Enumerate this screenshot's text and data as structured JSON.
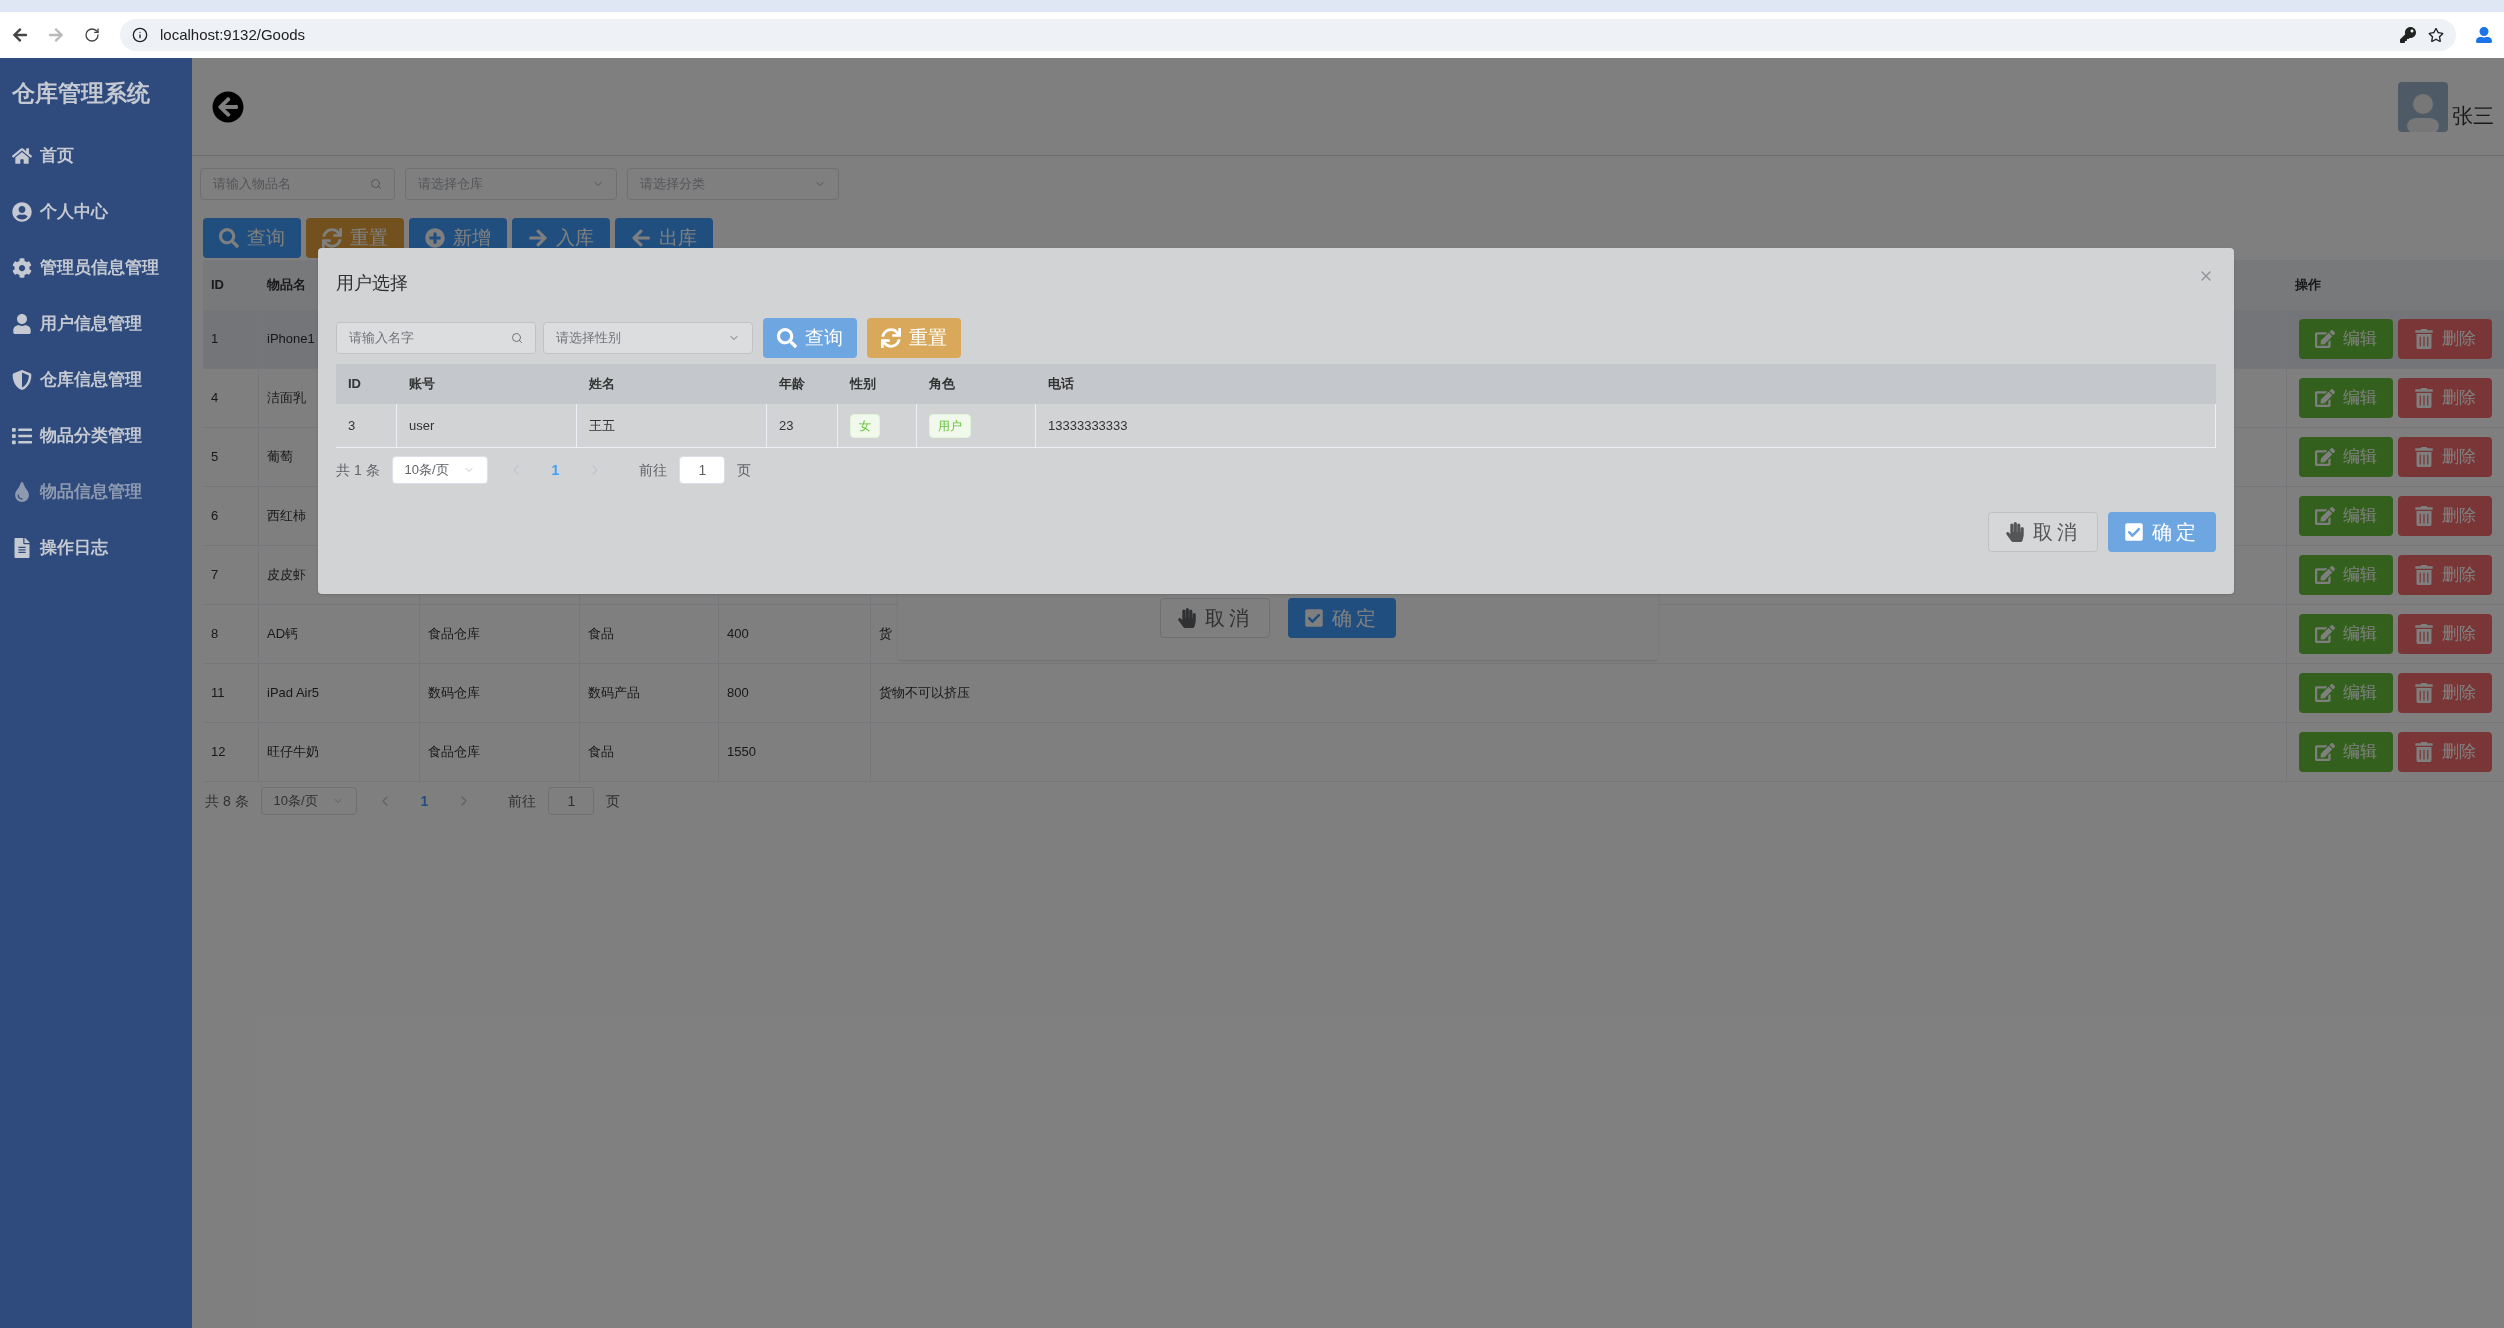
{
  "browser": {
    "url": "localhost:9132/Goods"
  },
  "sidebar": {
    "title": "仓库管理系统",
    "items": [
      {
        "label": "首页",
        "kind": "home",
        "selected": false
      },
      {
        "label": "个人中心",
        "kind": "profile",
        "selected": false
      },
      {
        "label": "管理员信息管理",
        "kind": "admin",
        "selected": false
      },
      {
        "label": "用户信息管理",
        "kind": "user",
        "selected": false
      },
      {
        "label": "仓库信息管理",
        "kind": "storage",
        "selected": false
      },
      {
        "label": "物品分类管理",
        "kind": "category",
        "selected": false
      },
      {
        "label": "物品信息管理",
        "kind": "goods",
        "selected": true
      },
      {
        "label": "操作日志",
        "kind": "log",
        "selected": false
      }
    ]
  },
  "header": {
    "user_name": "张三"
  },
  "filters": [
    {
      "placeholder": "请输入物品名",
      "kind": "search"
    },
    {
      "placeholder": "请选择仓库",
      "kind": "select"
    },
    {
      "placeholder": "请选择分类",
      "kind": "select"
    }
  ],
  "toolbar": [
    {
      "label": "查询",
      "kind": "search"
    },
    {
      "label": "重置",
      "kind": "reset"
    },
    {
      "label": "新增",
      "kind": "add"
    },
    {
      "label": "入库",
      "kind": "in"
    },
    {
      "label": "出库",
      "kind": "out"
    }
  ],
  "table": {
    "columns": [
      "ID",
      "物品名",
      null,
      null,
      null,
      null,
      "操作"
    ],
    "rows": [
      {
        "cells": [
          "1",
          "iPhone1",
          null,
          null,
          null,
          null
        ],
        "selected": true,
        "actions": [
          "编辑",
          "删除"
        ]
      },
      {
        "cells": [
          "4",
          "洁面乳",
          null,
          null,
          null,
          null
        ],
        "selected": false,
        "actions": [
          "编辑",
          "删除"
        ]
      },
      {
        "cells": [
          "5",
          "葡萄",
          null,
          null,
          null,
          null
        ],
        "selected": false,
        "actions": [
          "编辑",
          "删除"
        ]
      },
      {
        "cells": [
          "6",
          "西红柿",
          null,
          null,
          null,
          null
        ],
        "selected": false,
        "actions": [
          "编辑",
          "删除"
        ]
      },
      {
        "cells": [
          "7",
          "皮皮虾",
          null,
          null,
          null,
          null
        ],
        "selected": false,
        "actions": [
          "编辑",
          "删除"
        ]
      },
      {
        "cells": [
          "8",
          "AD钙",
          "食品仓库",
          "食品",
          "400",
          "货"
        ],
        "selected": false,
        "actions": [
          "编辑",
          "删除"
        ]
      },
      {
        "cells": [
          "11",
          "iPad Air5",
          "数码仓库",
          "数码产品",
          "800",
          "货物不可以挤压"
        ],
        "selected": false,
        "actions": [
          "编辑",
          "删除"
        ]
      },
      {
        "cells": [
          "12",
          "旺仔牛奶",
          "食品仓库",
          "食品",
          "1550",
          null
        ],
        "selected": false,
        "actions": [
          "编辑",
          "删除"
        ]
      }
    ]
  },
  "pagination": {
    "total": "共 8 条",
    "page_size": "10条/页",
    "pages": [
      {
        "label": "1",
        "selected": true
      }
    ],
    "goto_label": "前往",
    "goto_value": "1",
    "goto_suffix": "页"
  },
  "stock_dialog": {
    "buttons": [
      {
        "label": "取消",
        "kind": "cancel"
      },
      {
        "label": "确定",
        "kind": "confirm"
      }
    ]
  },
  "user_dialog": {
    "title": "用户选择",
    "search_placeholder": "请输入名字",
    "gender_placeholder": "请选择性别",
    "buttons": [
      {
        "label": "查询",
        "kind": "search"
      },
      {
        "label": "重置",
        "kind": "reset"
      }
    ],
    "table": {
      "columns": [
        "ID",
        "账号",
        "姓名",
        "年龄",
        "性别",
        "角色",
        "电话"
      ],
      "rows": [
        {
          "cells": [
            "3",
            "user",
            "王五",
            "23",
            "女",
            "用户",
            "13333333333"
          ]
        }
      ]
    },
    "pagination": {
      "total": "共 1 条",
      "page_size": "10条/页",
      "pages": [
        {
          "label": "1",
          "selected": true
        }
      ],
      "goto_label": "前往",
      "goto_value": "1",
      "goto_suffix": "页"
    },
    "footer_buttons": [
      {
        "label": "取消",
        "kind": "cancel"
      },
      {
        "label": "确定",
        "kind": "confirm"
      }
    ]
  }
}
